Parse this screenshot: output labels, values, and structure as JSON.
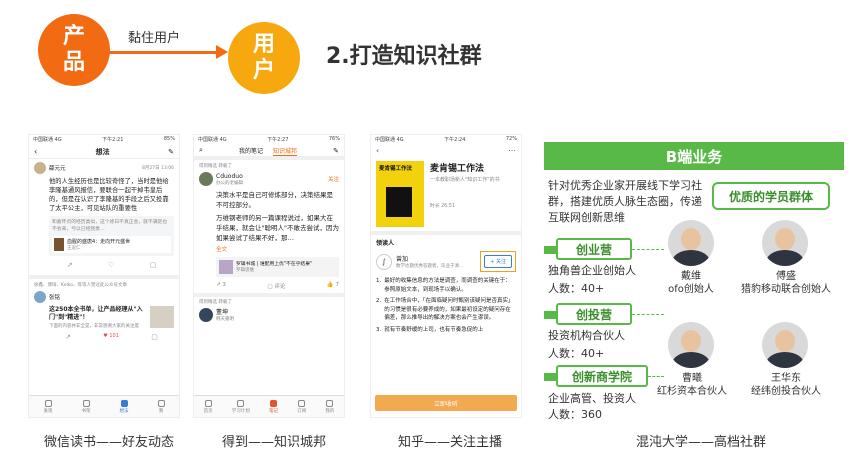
{
  "header": {
    "circle_left": "产品",
    "circle_right": "用户",
    "arrow_label": "黏住用户",
    "title": "2.打造知识社群"
  },
  "phone1": {
    "status_left": "中国联通 4G",
    "status_time": "下午2:21",
    "status_right": "85%",
    "nav_title": "想法",
    "user": "薛元元",
    "date": "8月27日 13:06",
    "post": "他的人生经历也是比较奇怪了，当时是他给李隆基通风报信，要联合一起干掉韦皇后的，但是在认识了李隆基的手段之后又投靠了太平公主，可见站队的重要性",
    "quote": "和素怀贞的经历类似，这个修日不真正会，就不满足也不会来，亏以已经我勇…",
    "book_title": "血腥的盛唐4：走向开元盛世",
    "book_author": "王逗仁",
    "liked_row": "徐鑫、博琦、Kelko、等等人赞过此公众号文章",
    "user2": "张铭",
    "post2": "这250本全书单，让产品经理从\"入门\"到\"精进\"！",
    "post2_sub": "下面的内容并非全是，非常感谢大家的关注度",
    "count": "101",
    "tabs": [
      "发现",
      "书架",
      "想法",
      "我"
    ]
  },
  "phone2": {
    "status_left": "中国联通 4G",
    "status_time": "下午2:27",
    "status_right": "76%",
    "tab_a": "我的笔记",
    "tab_b": "知识城邦",
    "reposter": "得到精选 转载了",
    "user": "Cduoduo",
    "user_sub": "办公的老编辑",
    "follow": "关注",
    "post": "决策水平是自己可修炼部分，决策结果是不可控部分。",
    "post2": "万维钢老师的另一篇课程说过，如果大在乎结果，就会让\"聪明人\"不敢去尝试，因为如果尝试了结果不好，那…",
    "more": "全文",
    "card_title": "罗辑书城 | 谁配用上优\"不在乎结果\"",
    "card_sub": "罗辑思维",
    "likes": "3",
    "comment": "评论",
    "like_count": "7",
    "reposter2": "得到精选 转载了",
    "user2": "董坤",
    "user2_sub": "韩天嘉明",
    "tabs": [
      "首页",
      "学习计划",
      "笔记",
      "订阅",
      "我的"
    ]
  },
  "phone3": {
    "status_left": "中国联通 4G",
    "status_time": "下午2:24",
    "status_right": "72%",
    "book_cover": "麦肯锡工作法",
    "book_title": "麦肯锡工作法",
    "book_desc": "一本教职场新人\"知识工作\"的书",
    "duration": "时长 26:51",
    "section": "领读人",
    "reader": "曾加",
    "reader_desc": "数学达题优秀答题者，毕业于清...",
    "follow_btn": "+ 关注",
    "p1": "最好的收集信息的方法是调查，而调查的关键在于：参照原始文本，到现场手以确认。",
    "p2": "在工作场合中，「在面临疑问时甄别该疑问是否真实」的习惯是很有必要养成的，如果最初设定的疑问存在偏差，那么推导出的解决方案也会产生谬误。",
    "p3": "就有节奏舒缓的上司，也有节奏急促的上",
    "cta": "立即收听"
  },
  "bside": {
    "title": "B端业务",
    "intro": "针对优秀企业家开展线下学习社群，搭建优质人脉生态圈，传递互联网创新思维",
    "badge_members": "优质的学员群体",
    "section1": "创业营",
    "s1_line1": "独角兽企业创始人",
    "s1_line2": "人数：40+",
    "section2": "创投营",
    "s2_line1": "投资机构合伙人",
    "s2_line2": "人数：40+",
    "section3": "创新商学院",
    "s3_line1": "企业高管、投资人",
    "s3_line2": "人数：360",
    "people": [
      {
        "name": "戴维",
        "role": "ofo创始人"
      },
      {
        "name": "傅盛",
        "role": "猎豹移动联合创始人"
      },
      {
        "name": "曹曦",
        "role": "红杉资本合伙人"
      },
      {
        "name": "王华东",
        "role": "经纬创投合伙人"
      }
    ]
  },
  "captions": {
    "c1": "微信读书——好友动态",
    "c2": "得到——知识城邦",
    "c3": "知乎——关注主播",
    "c4": "混沌大学——高档社群"
  }
}
